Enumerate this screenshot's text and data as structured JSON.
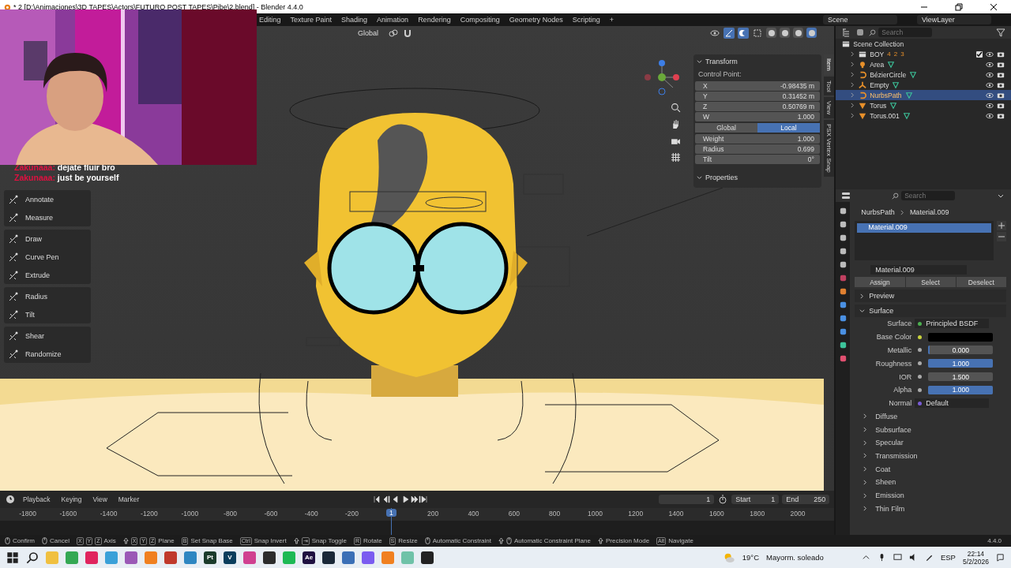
{
  "window": {
    "title": "* 2 [D:\\Animaciones\\3D TAPES\\Actors\\FUTURO POST TAPES\\Pibe\\2.blend] - Blender 4.4.0"
  },
  "workspace_tabs": [
    "Editing",
    "Texture Paint",
    "Shading",
    "Animation",
    "Rendering",
    "Compositing",
    "Geometry Nodes",
    "Scripting",
    "+"
  ],
  "scene": "Scene",
  "view_layer": "ViewLayer",
  "webcam": {
    "kind": "picture"
  },
  "chat": [
    {
      "user": "Zakunaaa:",
      "message": "dejate fluir bro"
    },
    {
      "user": "Zakunaaa:",
      "message": "just be yourself"
    }
  ],
  "viewport_header": {
    "orientation": "Global",
    "shading_modes": [
      {
        "selected": false
      },
      {
        "selected": false
      },
      {
        "selected": false
      },
      {
        "selected": true
      }
    ]
  },
  "tool_groups": [
    [
      "Annotate",
      "Measure"
    ],
    [
      "Draw",
      "Curve Pen",
      "Extrude"
    ],
    [
      "Radius",
      "Tilt"
    ],
    [
      "Shear",
      "Randomize"
    ]
  ],
  "sidebar": {
    "tabs": [
      {
        "label": "Item",
        "selected": true
      },
      {
        "label": "Tool",
        "selected": false
      },
      {
        "label": "View",
        "selected": false
      },
      {
        "label": "PSX Vertex Snap",
        "selected": false
      }
    ],
    "transform_title": "Transform",
    "control_point_label": "Control Point:",
    "coords": [
      {
        "label": "X",
        "value": "-0.98435 m"
      },
      {
        "label": "Y",
        "value": "0.31452 m"
      },
      {
        "label": "Z",
        "value": "0.50769 m"
      },
      {
        "label": "W",
        "value": "1.000"
      }
    ],
    "space": [
      {
        "label": "Global",
        "selected": false
      },
      {
        "label": "Local",
        "selected": true
      }
    ],
    "props": [
      {
        "label": "Weight",
        "value": "1.000"
      },
      {
        "label": "Radius",
        "value": "0.699"
      },
      {
        "label": "Tilt",
        "value": "0°"
      }
    ],
    "properties_title": "Properties"
  },
  "outliner": {
    "search_placeholder": "Search",
    "root": "Scene Collection",
    "items": [
      {
        "name": "BOY",
        "kind": "collection",
        "selected": false,
        "checked": true,
        "counts": [
          "4",
          "2",
          "3"
        ]
      },
      {
        "name": "Area",
        "kind": "light",
        "selected": false
      },
      {
        "name": "BézierCircle",
        "kind": "curve",
        "selected": false
      },
      {
        "name": "Empty",
        "kind": "empty",
        "selected": false
      },
      {
        "name": "NurbsPath",
        "kind": "curve",
        "selected": true
      },
      {
        "name": "Torus",
        "kind": "mesh",
        "selected": false
      },
      {
        "name": "Torus.001",
        "kind": "mesh",
        "selected": false
      }
    ]
  },
  "properties": {
    "search_placeholder": "Search",
    "breadcrumb": [
      "NurbsPath",
      "Material.009"
    ],
    "slots": [
      {
        "name": "Material.009",
        "selected": true
      }
    ],
    "material_name": "Material.009",
    "slot_buttons": [
      "Assign",
      "Select",
      "Deselect"
    ],
    "panels": [
      {
        "title": "Preview",
        "expanded": false
      },
      {
        "title": "Surface",
        "expanded": true
      }
    ],
    "rows": [
      {
        "kind": "shader",
        "label": "Surface",
        "value": "Principled BSDF",
        "color": "#4caf50"
      },
      {
        "kind": "color",
        "label": "Base Color",
        "color": "#000000"
      },
      {
        "kind": "slider",
        "label": "Metallic",
        "value": "0.000",
        "level": 0
      },
      {
        "kind": "slider",
        "label": "Roughness",
        "value": "1.000",
        "level": 1
      },
      {
        "kind": "number",
        "label": "IOR",
        "value": "1.500"
      },
      {
        "kind": "slider",
        "label": "Alpha",
        "value": "1.000",
        "level": 1
      },
      {
        "kind": "shader",
        "label": "Normal",
        "value": "Default",
        "color": "#7a5cd6"
      }
    ],
    "subpanels": [
      "Diffuse",
      "Subsurface",
      "Specular",
      "Transmission",
      "Coat",
      "Sheen",
      "Emission",
      "Thin Film"
    ]
  },
  "timeline": {
    "menus": [
      "Playback",
      "Keying",
      "View",
      "Marker"
    ],
    "current_frame": "1",
    "start_label": "Start",
    "start": "1",
    "end_label": "End",
    "end": "250",
    "ticks": [
      "-1800",
      "-1600",
      "-1400",
      "-1200",
      "-1000",
      "-800",
      "-600",
      "-400",
      "-200",
      "200",
      "400",
      "600",
      "800",
      "1000",
      "1200",
      "1400",
      "1600",
      "1800",
      "2000"
    ],
    "playhead": "1"
  },
  "status_bar": {
    "items": [
      {
        "shift": false,
        "mouse": true,
        "label": "Confirm"
      },
      {
        "shift": false,
        "mouse": true,
        "label": "Cancel"
      },
      {
        "keys": [
          "X",
          "Y",
          "Z"
        ],
        "shift": false,
        "mouse": false,
        "label": "Axis"
      },
      {
        "keys": [
          "X",
          "Y",
          "Z"
        ],
        "shift": true,
        "mouse": false,
        "label": "Plane"
      },
      {
        "keys": [
          "B"
        ],
        "shift": false,
        "mouse": false,
        "label": "Set Snap Base"
      },
      {
        "keys": [
          "Ctrl"
        ],
        "shift": false,
        "mouse": false,
        "label": "Snap Invert"
      },
      {
        "keys": [
          "⇥"
        ],
        "shift": true,
        "mouse": false,
        "label": "Snap Toggle"
      },
      {
        "keys": [
          "R"
        ],
        "shift": false,
        "mouse": false,
        "label": "Rotate"
      },
      {
        "keys": [
          "S"
        ],
        "shift": false,
        "mouse": false,
        "label": "Resize"
      },
      {
        "shift": false,
        "mouse": true,
        "label": "Automatic Constraint"
      },
      {
        "shift": true,
        "mouse": true,
        "label": "Automatic Constraint Plane"
      },
      {
        "shift": true,
        "mouse": false,
        "label": "Precision Mode"
      },
      {
        "keys": [
          "Alt"
        ],
        "shift": false,
        "mouse": false,
        "label": "Navigate"
      }
    ],
    "version": "4.4.0"
  },
  "taskbar": {
    "apps": [
      {
        "color": "#f0c040"
      },
      {
        "color": "#34a853"
      },
      {
        "color": "#e0245e"
      },
      {
        "color": "#3aa0d8"
      },
      {
        "color": "#9b59b6"
      },
      {
        "color": "#f08020"
      },
      {
        "color": "#c0392b"
      },
      {
        "color": "#2e86c1"
      },
      {
        "color": "#1b3b2b",
        "label": "Pt"
      },
      {
        "color": "#0a3d5c",
        "label": "V"
      },
      {
        "color": "#d04090"
      },
      {
        "color": "#2c2c2c"
      },
      {
        "color": "#1db954"
      },
      {
        "color": "#1f1040",
        "label": "Ae"
      },
      {
        "color": "#1b2838"
      },
      {
        "color": "#3b6fb6"
      },
      {
        "color": "#7b5cf0"
      },
      {
        "color": "#f08020"
      },
      {
        "color": "#6fc2a8"
      },
      {
        "color": "#222222"
      }
    ],
    "weather_temp": "19°C",
    "weather_text": "Mayorm. soleado",
    "language": "ESP",
    "time": "22:14",
    "date": "5/2/2026"
  }
}
